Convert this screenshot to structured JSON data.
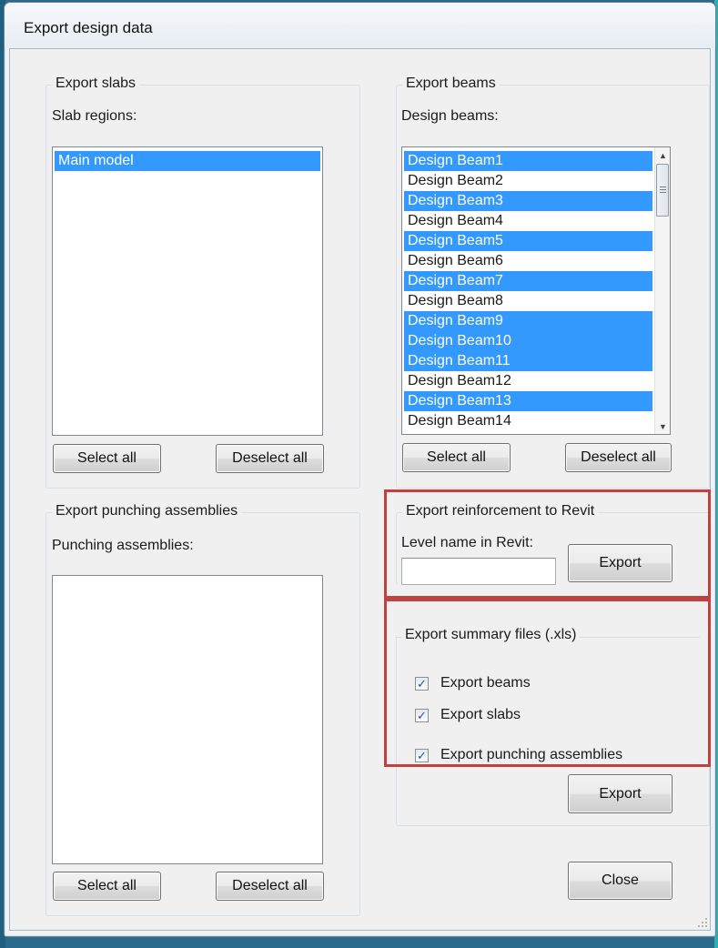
{
  "window": {
    "title": "Export design data"
  },
  "slabs": {
    "group_label": "Export slabs",
    "list_label": "Slab regions:",
    "items": [
      {
        "label": "Main model",
        "selected": true
      }
    ],
    "select_all_label": "Select all",
    "deselect_all_label": "Deselect all"
  },
  "beams": {
    "group_label": "Export beams",
    "list_label": "Design beams:",
    "items": [
      {
        "label": "Design Beam1",
        "selected": true
      },
      {
        "label": "Design Beam2",
        "selected": false
      },
      {
        "label": "Design Beam3",
        "selected": true
      },
      {
        "label": "Design Beam4",
        "selected": false
      },
      {
        "label": "Design Beam5",
        "selected": true
      },
      {
        "label": "Design Beam6",
        "selected": false
      },
      {
        "label": "Design Beam7",
        "selected": true
      },
      {
        "label": "Design Beam8",
        "selected": false
      },
      {
        "label": "Design Beam9",
        "selected": true
      },
      {
        "label": "Design Beam10",
        "selected": true
      },
      {
        "label": "Design Beam11",
        "selected": true
      },
      {
        "label": "Design Beam12",
        "selected": false
      },
      {
        "label": "Design Beam13",
        "selected": true
      },
      {
        "label": "Design Beam14",
        "selected": false
      }
    ],
    "select_all_label": "Select all",
    "deselect_all_label": "Deselect all"
  },
  "punching": {
    "group_label": "Export punching assemblies",
    "list_label": "Punching assemblies:",
    "select_all_label": "Select all",
    "deselect_all_label": "Deselect all"
  },
  "revit": {
    "group_label": "Export reinforcement to Revit",
    "level_label": "Level name in Revit:",
    "level_value": "",
    "export_label": "Export"
  },
  "summary": {
    "group_label": "Export summary files (.xls)",
    "options": [
      {
        "label": "Export beams",
        "checked": true
      },
      {
        "label": "Export slabs",
        "checked": true
      },
      {
        "label": "Export punching assemblies",
        "checked": true
      }
    ],
    "export_label": "Export"
  },
  "close_label": "Close",
  "colors": {
    "selection": "#3399ff",
    "highlight_border": "#c0413f",
    "dialog_bg": "#f0f0f0"
  }
}
